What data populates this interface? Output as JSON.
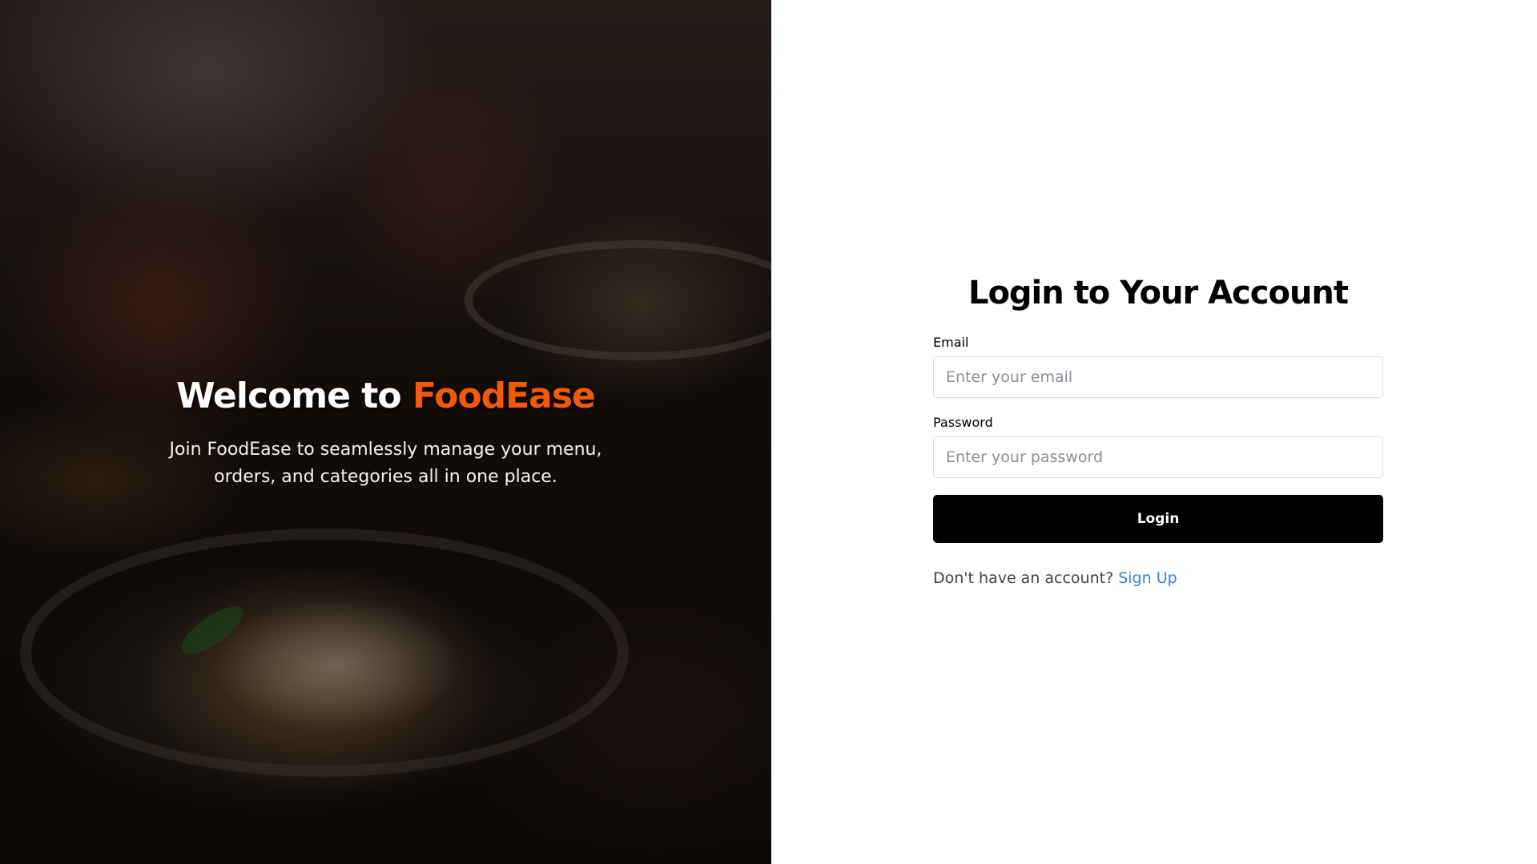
{
  "hero": {
    "title_prefix": "Welcome to ",
    "brand_name": "FoodEase",
    "subtitle": "Join FoodEase to seamlessly manage your menu, orders, and categories all in one place."
  },
  "login": {
    "title": "Login to Your Account",
    "email_label": "Email",
    "email_placeholder": "Enter your email",
    "email_value": "",
    "password_label": "Password",
    "password_placeholder": "Enter your password",
    "password_value": "",
    "button_label": "Login",
    "signup_prompt": "Don't have an account?",
    "signup_link": "Sign Up"
  },
  "colors": {
    "brand_accent": "#f25a0b",
    "button_bg": "#000000",
    "link": "#3b7fd4"
  }
}
